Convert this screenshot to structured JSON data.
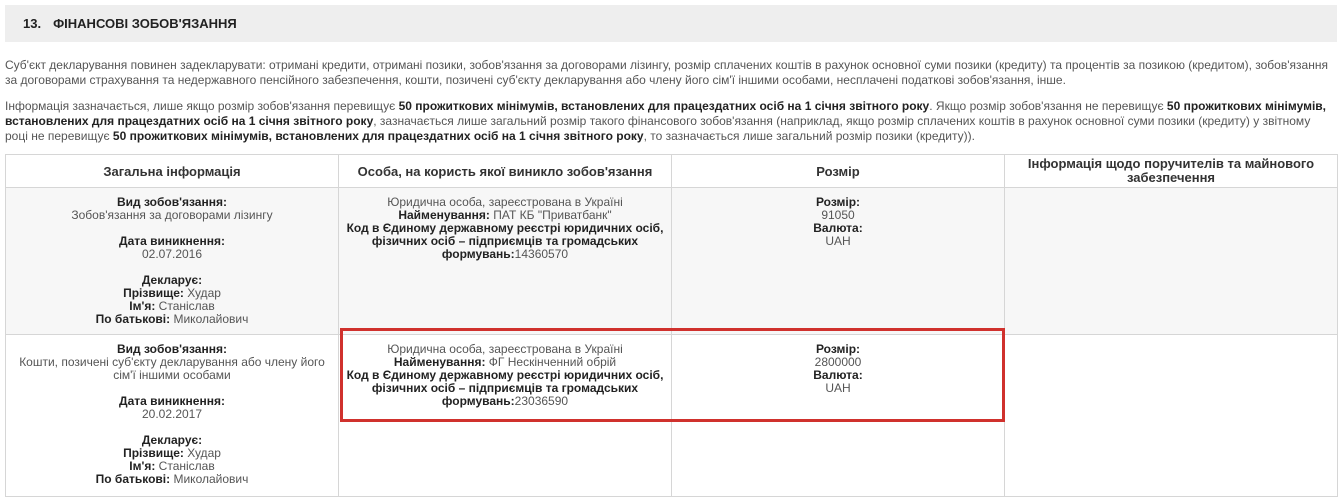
{
  "section": {
    "number": "13.",
    "title": "ФІНАНСОВІ ЗОБОВ'ЯЗАННЯ"
  },
  "intro": {
    "p1": "Суб'єкт декларування повинен задекларувати: отримані кредити, отримані позики, зобов'язання за договорами лізингу, розмір сплачених коштів в рахунок основної суми позики (кредиту) та процентів за позикою (кредитом), зобов'язання за договорами страхування та недержавного пенсійного забезпечення, кошти, позичені суб'єкту декларування або члену його сім'ї іншими особами, несплачені податкові зобов'язання, інше.",
    "p2_a": "Інформація зазначається, лише якщо розмір зобов'язання перевищує ",
    "p2_b": "50 прожиткових мінімумів, встановлених для працездатних осіб на 1 січня звітного року",
    "p2_c": ". Якщо розмір зобов'язання не перевищує ",
    "p2_d": "50 прожиткових мінімумів, встановлених для працездатних осіб на 1 січня звітного року",
    "p2_e": ", зазначається лише загальний розмір такого фінансового зобов'язання (наприклад, якщо розмір сплачених коштів в рахунок основної суми позики (кредиту) у звітному році не перевищує ",
    "p2_f": "50 прожиткових мінімумів, встановлених для працездатних осіб на 1 січня звітного року",
    "p2_g": ", то зазначається лише загальний розмір позики (кредиту))."
  },
  "table": {
    "headers": [
      "Загальна інформація",
      "Особа, на користь якої виникло зобов'язання",
      "Розмір",
      "Інформація щодо поручителів та майнового забезпечення"
    ],
    "labels": {
      "type": "Вид зобов'язання:",
      "date": "Дата виникнення:",
      "declarant": "Декларує:",
      "surname": "Прізвище:",
      "name": "Ім'я:",
      "patronymic": "По батькові:",
      "org_name": "Найменування:",
      "org_code": "Код в Єдиному державному реєстрі юридичних осіб, фізичних осіб – підприємців та громадських формувань:",
      "size": "Розмір:",
      "currency": "Валюта:"
    },
    "rows": [
      {
        "type": "Зобов'язання за договорами лізингу",
        "date": "02.07.2016",
        "surname": "Худар",
        "name": "Станіслав",
        "patronymic": "Миколайович",
        "entity": "Юридична особа, зареєстрована в Україні",
        "org_name": "ПАТ КБ \"Приватбанк\"",
        "org_code": "14360570",
        "size": "91050",
        "currency": "UAH"
      },
      {
        "type": "Кошти, позичені суб'єкту декларування або члену його сім'ї іншими особами",
        "date": "20.02.2017",
        "surname": "Худар",
        "name": "Станіслав",
        "patronymic": "Миколайович",
        "entity": "Юридична особа, зареєстрована в Україні",
        "org_name": "ФГ Нескінченний обрій",
        "org_code": "23036590",
        "size": "2800000",
        "currency": "UAH"
      }
    ]
  },
  "colors": {
    "header_bg": "#eeeeee",
    "row_alt_bg": "#f7f7f7",
    "highlight": "#d0312d"
  }
}
